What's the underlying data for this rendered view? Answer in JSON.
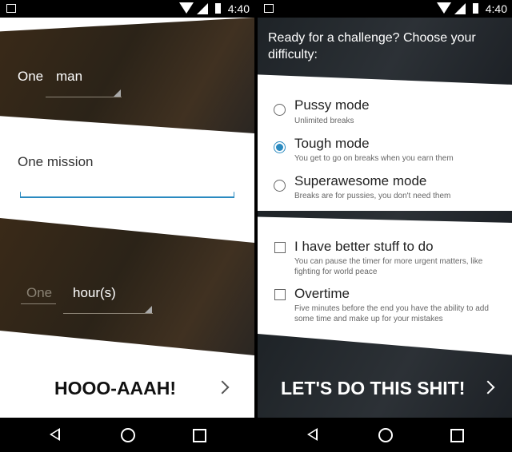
{
  "status": {
    "time": "4:40"
  },
  "left": {
    "one_label": "One",
    "man_value": "man",
    "mission_label": "One mission",
    "hours_placeholder": "One",
    "hours_unit": "hour(s)",
    "cta_label": "HOOO-AAAH!"
  },
  "right": {
    "prompt": "Ready for a challenge? Choose your difficulty:",
    "difficulty": [
      {
        "title": "Pussy mode",
        "subtitle": "Unlimited breaks",
        "selected": false
      },
      {
        "title": "Tough mode",
        "subtitle": "You get to go on breaks when you earn them",
        "selected": true
      },
      {
        "title": "Superawesome mode",
        "subtitle": "Breaks are for pussies, you don't need them",
        "selected": false
      }
    ],
    "options": [
      {
        "title": "I have better stuff to do",
        "subtitle": "You can pause the timer for more urgent matters, like fighting for world peace",
        "checked": false
      },
      {
        "title": "Overtime",
        "subtitle": "Five minutes before the end you have the ability to add some time and make up for your mistakes",
        "checked": false
      }
    ],
    "cta_label": "LET'S DO THIS SHIT!"
  },
  "colors": {
    "accent": "#2a8ac0"
  }
}
